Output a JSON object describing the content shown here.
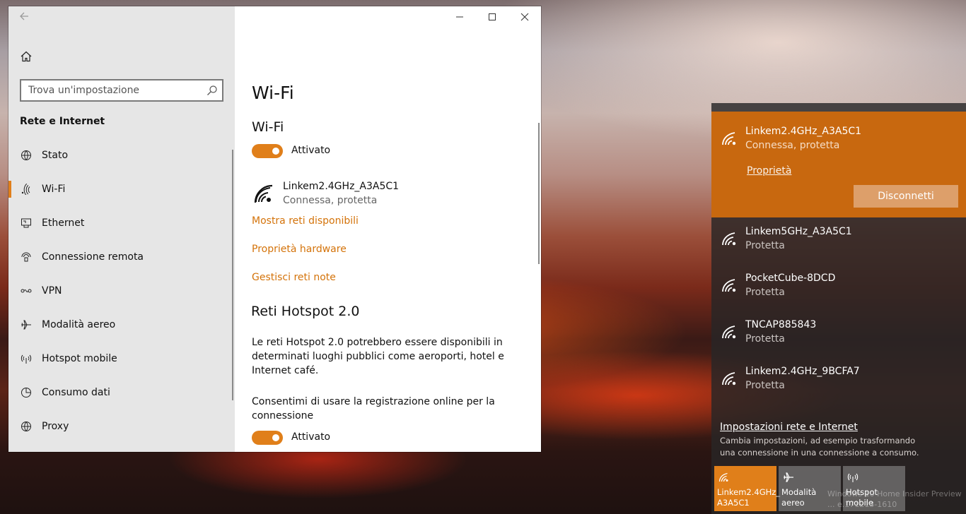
{
  "settings": {
    "search_placeholder": "Trova un'impostazione",
    "section_title": "Rete e Internet",
    "nav": [
      {
        "label": "Stato",
        "icon": "globe-icon"
      },
      {
        "label": "Wi-Fi",
        "icon": "wifi-icon",
        "active": true
      },
      {
        "label": "Ethernet",
        "icon": "ethernet-icon"
      },
      {
        "label": "Connessione remota",
        "icon": "dialup-icon"
      },
      {
        "label": "VPN",
        "icon": "vpn-icon"
      },
      {
        "label": "Modalità aereo",
        "icon": "airplane-icon"
      },
      {
        "label": "Hotspot mobile",
        "icon": "hotspot-icon"
      },
      {
        "label": "Consumo dati",
        "icon": "data-usage-icon"
      },
      {
        "label": "Proxy",
        "icon": "proxy-globe-icon"
      }
    ],
    "page_title": "Wi-Fi",
    "wifi_section_title": "Wi-Fi",
    "wifi_toggle_label": "Attivato",
    "network": {
      "name": "Linkem2.4GHz_A3A5C1",
      "status": "Connessa, protetta"
    },
    "links": {
      "show_networks": "Mostra reti disponibili",
      "hardware_props": "Proprietà hardware",
      "manage_known": "Gestisci reti note"
    },
    "hotspot_title": "Reti Hotspot 2.0",
    "hotspot_desc": "Le reti Hotspot 2.0 potrebbero essere disponibili in determinati luoghi pubblici come aeroporti, hotel e Internet café.",
    "online_signup_desc": "Consentimi di usare la registrazione online per la connessione",
    "online_signup_toggle_label": "Attivato"
  },
  "flyout": {
    "connected": {
      "name": "Linkem2.4GHz_A3A5C1",
      "status": "Connessa, protetta",
      "properties": "Proprietà",
      "disconnect": "Disconnetti"
    },
    "networks": [
      {
        "name": "Linkem5GHz_A3A5C1",
        "status": "Protetta"
      },
      {
        "name": "PocketCube-8DCD",
        "status": "Protetta"
      },
      {
        "name": "TNCAP885843",
        "status": "Protetta"
      },
      {
        "name": "Linkem2.4GHz_9BCFA7",
        "status": "Protetta"
      }
    ],
    "settings_link": "Impostazioni rete e Internet",
    "settings_desc": "Cambia impostazioni, ad esempio trasformando una connessione in una connessione a consumo.",
    "tiles": [
      {
        "label": "Linkem2.4GHz_ A3A5C1",
        "icon": "wifi-icon",
        "on": true
      },
      {
        "label": "Modalità aereo",
        "icon": "airplane-icon",
        "on": false
      },
      {
        "label": "Hotspot mobile",
        "icon": "hotspot-icon",
        "on": false
      }
    ]
  },
  "watermark": "Windows 10 Home Insider Preview ... e.171213-1610",
  "colors": {
    "accent": "#e07f1a",
    "flyout_accent": "#c8680f",
    "link": "#d4730a"
  }
}
